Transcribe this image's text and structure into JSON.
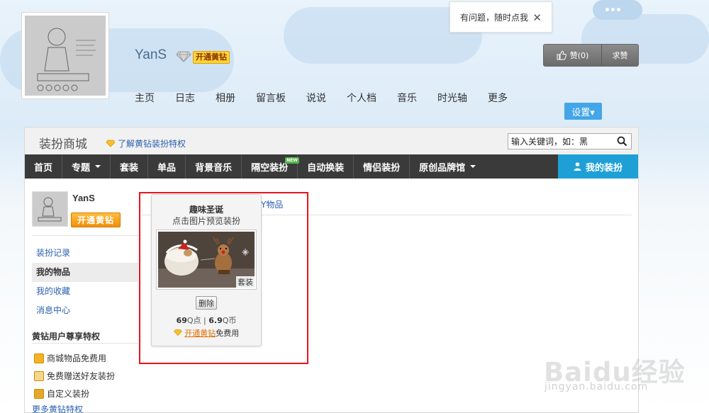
{
  "help_popup": {
    "text": "有问题，随时点我",
    "close": "✕"
  },
  "profile": {
    "username": "YanS",
    "vip_badge": "开通黄钻",
    "nav": [
      "主页",
      "日志",
      "相册",
      "留言板",
      "说说",
      "个人档",
      "音乐",
      "时光轴",
      "更多"
    ],
    "like_label": "赞(0)",
    "ask_label": "求赞",
    "settings_label": "设置▾"
  },
  "mall": {
    "title": "装扮商城",
    "vip_link": "了解黄钻装扮特权",
    "search_value": "输入关键词，如：黑",
    "nav": [
      {
        "label": "首页",
        "dropdown": false,
        "new": false
      },
      {
        "label": "专题",
        "dropdown": true,
        "new": false
      },
      {
        "label": "套装",
        "dropdown": false,
        "new": false
      },
      {
        "label": "单品",
        "dropdown": false,
        "new": false
      },
      {
        "label": "背景音乐",
        "dropdown": false,
        "new": false
      },
      {
        "label": "隔空装扮",
        "dropdown": false,
        "new": true
      },
      {
        "label": "自动换装",
        "dropdown": false,
        "new": false
      },
      {
        "label": "情侣装扮",
        "dropdown": false,
        "new": false
      },
      {
        "label": "原创品牌馆",
        "dropdown": true,
        "new": false
      }
    ],
    "new_badge": "NEW",
    "my_outfit": "我的装扮"
  },
  "sidebar": {
    "username": "YanS",
    "vip_button": "开通黄钻",
    "links": [
      {
        "label": "装扮记录",
        "active": false
      },
      {
        "label": "我的物品",
        "active": true
      },
      {
        "label": "我的收藏",
        "active": false
      },
      {
        "label": "消息中心",
        "active": false
      }
    ],
    "vip_title": "黄钻用户尊享特权",
    "perks": [
      "商城物品免费用",
      "免费赠送好友装扮",
      "自定义装扮"
    ],
    "more_vip": "更多黄钻特权"
  },
  "content": {
    "tab_text": "Y物品"
  },
  "item_card": {
    "title": "趣味圣诞",
    "subtitle": "点击图片预览装扮",
    "tag": "套装",
    "delete_label": "删除",
    "price_q": "69",
    "price_q_unit": "Q点",
    "price_sep": "|",
    "price_coin": "6.9",
    "price_coin_unit": "Q币",
    "open_vip": "开通黄钻",
    "free_use": "免费用"
  },
  "watermark": {
    "brand": "Baidu经验",
    "url": "jingyan.baidu.com"
  },
  "colors": {
    "nav_bg": "#3a3a3a",
    "my_outfit_bg": "#1ea0d7",
    "highlight_box": "#e8141e",
    "link": "#2a62b0",
    "vip_gold": "#ffd33a"
  }
}
